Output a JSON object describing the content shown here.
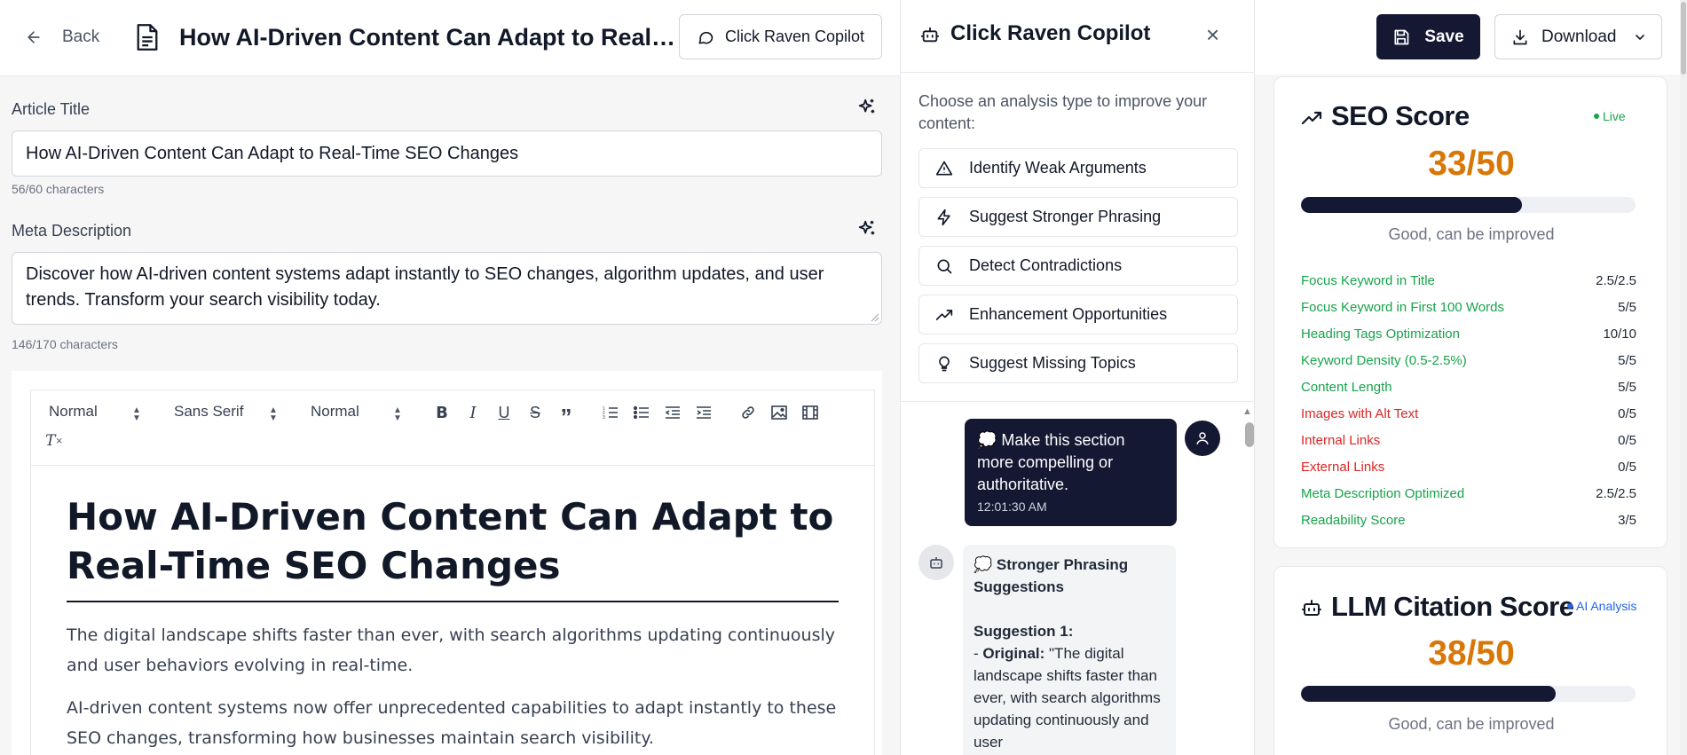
{
  "header": {
    "back_label": "Back",
    "title": "How AI-Driven Content Can Adapt to Real-Tim...",
    "copilot_button": "Click Raven Copilot"
  },
  "form": {
    "title_label": "Article Title",
    "title_value": "How AI-Driven Content Can Adapt to Real-Time SEO Changes",
    "title_count": "56/60 characters",
    "meta_label": "Meta Description",
    "meta_value": "Discover how AI-driven content systems adapt instantly to SEO changes, algorithm updates, and user trends. Transform your search visibility today.",
    "meta_count": "146/170 characters"
  },
  "toolbar": {
    "heading_select": "Normal",
    "font_select": "Sans Serif",
    "size_select": "Normal",
    "icons": [
      "bold-icon",
      "italic-icon",
      "underline-icon",
      "strikethrough-icon",
      "blockquote-icon",
      "ordered-list-icon",
      "bullet-list-icon",
      "outdent-icon",
      "indent-icon",
      "link-icon",
      "image-icon",
      "video-icon",
      "clear-format-icon"
    ]
  },
  "editor": {
    "h1": "How AI-Driven Content Can Adapt to Real-Time SEO Changes",
    "p1": "The digital landscape shifts faster than ever, with search algorithms updating continuously and user behaviors evolving in real-time.",
    "p2": "AI-driven content systems now offer unprecedented capabilities to adapt instantly to these SEO changes, transforming how businesses maintain search visibility."
  },
  "copilot": {
    "title": "Click Raven Copilot",
    "intro": "Choose an analysis type to improve your content:",
    "options": [
      {
        "label": "Identify Weak Arguments",
        "icon": "warning-triangle-icon"
      },
      {
        "label": "Suggest Stronger Phrasing",
        "icon": "lightning-icon"
      },
      {
        "label": "Detect Contradictions",
        "icon": "search-icon"
      },
      {
        "label": "Enhancement Opportunities",
        "icon": "trending-up-icon"
      },
      {
        "label": "Suggest Missing Topics",
        "icon": "lightbulb-icon"
      }
    ],
    "user_message": "💭 Make this section more compelling or authoritative.",
    "user_time": "12:01:30 AM",
    "bot_heading": "💭 Stronger Phrasing Suggestions",
    "bot_suggestion_label": "Suggestion 1:",
    "bot_original_prefix": "- ",
    "bot_original_label": "Original:",
    "bot_original_text": " \"The digital landscape shifts faster than ever, with search algorithms updating continuously and user"
  },
  "actions": {
    "save": "Save",
    "download": "Download"
  },
  "seo": {
    "title": "SEO Score",
    "badge": "Live",
    "score": "33/50",
    "progress": 0.66,
    "sublabel": "Good, can be improved",
    "metrics": [
      {
        "label": "Focus Keyword in Title",
        "value": "2.5/2.5",
        "status": "pass"
      },
      {
        "label": "Focus Keyword in First 100 Words",
        "value": "5/5",
        "status": "pass"
      },
      {
        "label": "Heading Tags Optimization",
        "value": "10/10",
        "status": "pass"
      },
      {
        "label": "Keyword Density (0.5-2.5%)",
        "value": "5/5",
        "status": "pass"
      },
      {
        "label": "Content Length",
        "value": "5/5",
        "status": "pass"
      },
      {
        "label": "Images with Alt Text",
        "value": "0/5",
        "status": "fail"
      },
      {
        "label": "Internal Links",
        "value": "0/5",
        "status": "fail"
      },
      {
        "label": "External Links",
        "value": "0/5",
        "status": "fail"
      },
      {
        "label": "Meta Description Optimized",
        "value": "2.5/2.5",
        "status": "pass"
      },
      {
        "label": "Readability Score",
        "value": "3/5",
        "status": "pass"
      }
    ]
  },
  "llm": {
    "title": "LLM Citation Score",
    "badge": "AI Analysis",
    "score": "38/50",
    "progress": 0.76,
    "sublabel": "Good, can be improved"
  },
  "colors": {
    "navy": "#141833",
    "score": "#d97706",
    "pass": "#16a34a",
    "fail": "#dc2626",
    "ai_badge": "#2563eb"
  }
}
